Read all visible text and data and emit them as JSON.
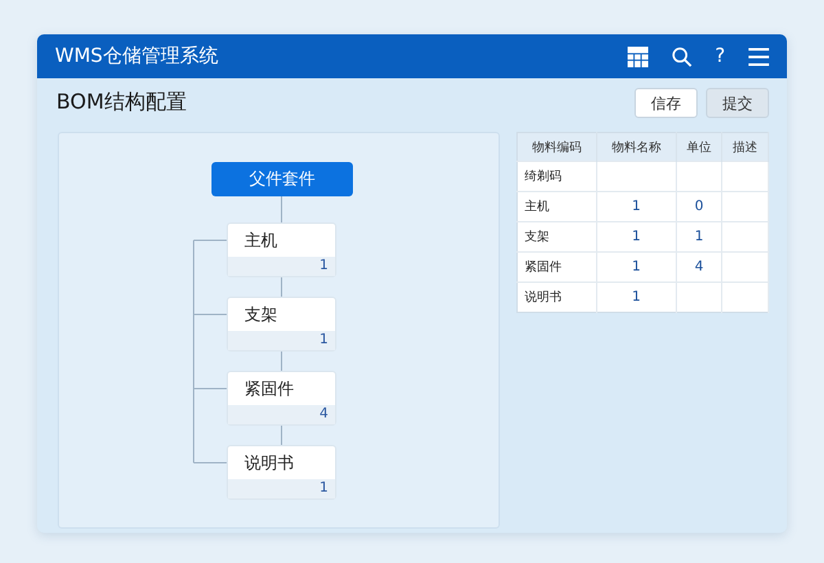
{
  "window": {
    "title": "WMS仓储管理系统",
    "help": "?"
  },
  "page": {
    "title": "BOM结构配置"
  },
  "buttons": [
    {
      "label": "信存",
      "primary": false
    },
    {
      "label": "提交",
      "primary": true
    }
  ],
  "tree": {
    "root": "父件套件",
    "children": [
      {
        "name": "主机",
        "qty": "1"
      },
      {
        "name": "支架",
        "qty": "1"
      },
      {
        "name": "紧固件",
        "qty": "4"
      },
      {
        "name": "说明书",
        "qty": "1"
      }
    ]
  },
  "table": {
    "columns": [
      "物料编码",
      "物料名称",
      "单位",
      "描述"
    ],
    "rows": [
      {
        "code": "绮剃码"
      },
      {
        "code": "主机",
        "name": "1",
        "unit": "0"
      },
      {
        "code": "支架",
        "name": "1",
        "unit": "1"
      },
      {
        "code": "紧固件",
        "name": "1",
        "unit": "4"
      },
      {
        "code": "说明书",
        "name": "1"
      }
    ]
  }
}
